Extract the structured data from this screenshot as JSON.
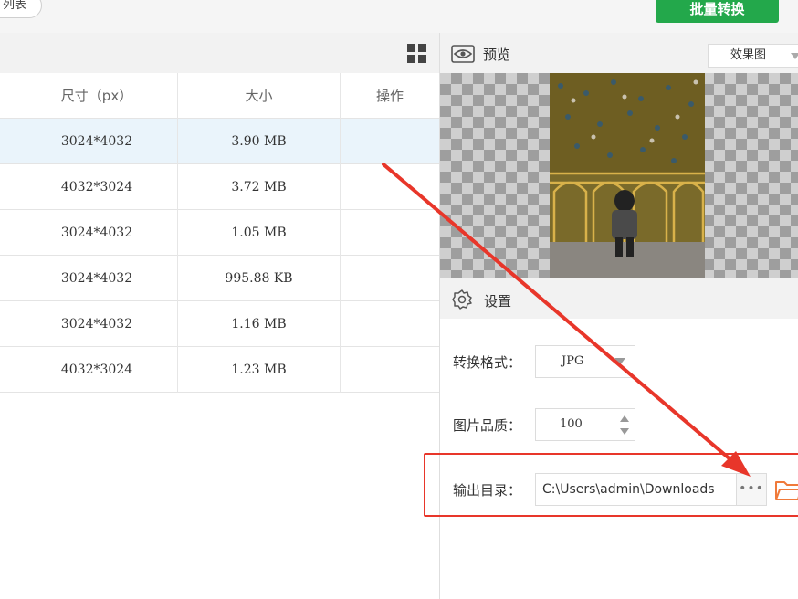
{
  "topbar": {
    "list_label": "列表",
    "batch_convert_label": "批量转换",
    "batch_color": "#23a84b"
  },
  "table": {
    "view_toggle_icon": "grid-icon",
    "columns": [
      "尺寸（px）",
      "大小",
      "操作"
    ],
    "rows": [
      {
        "dimensions": "3024*4032",
        "size": "3.90 MB",
        "selected": true
      },
      {
        "dimensions": "4032*3024",
        "size": "3.72 MB",
        "selected": false
      },
      {
        "dimensions": "3024*4032",
        "size": "1.05 MB",
        "selected": false
      },
      {
        "dimensions": "3024*4032",
        "size": "995.88 KB",
        "selected": false
      },
      {
        "dimensions": "3024*4032",
        "size": "1.16 MB",
        "selected": false
      },
      {
        "dimensions": "4032*3024",
        "size": "1.23 MB",
        "selected": false
      }
    ],
    "row_action_icons": [
      "open-external-icon",
      "trash-icon"
    ],
    "action_color": "#f07a3a"
  },
  "preview": {
    "label": "预览",
    "icon": "eye-icon",
    "mode_selected": "效果图"
  },
  "settings": {
    "label": "设置",
    "icon": "gear-icon",
    "format_label": "转换格式：",
    "format_value": "JPG",
    "quality_label": "图片品质：",
    "quality_value": "100",
    "output_label": "输出目录：",
    "output_value": "C:\\Users\\admin\\Downloads",
    "browse_label": "•••",
    "folder_icon": "folder-icon"
  },
  "annotation": {
    "highlight_color": "#e8362a"
  }
}
